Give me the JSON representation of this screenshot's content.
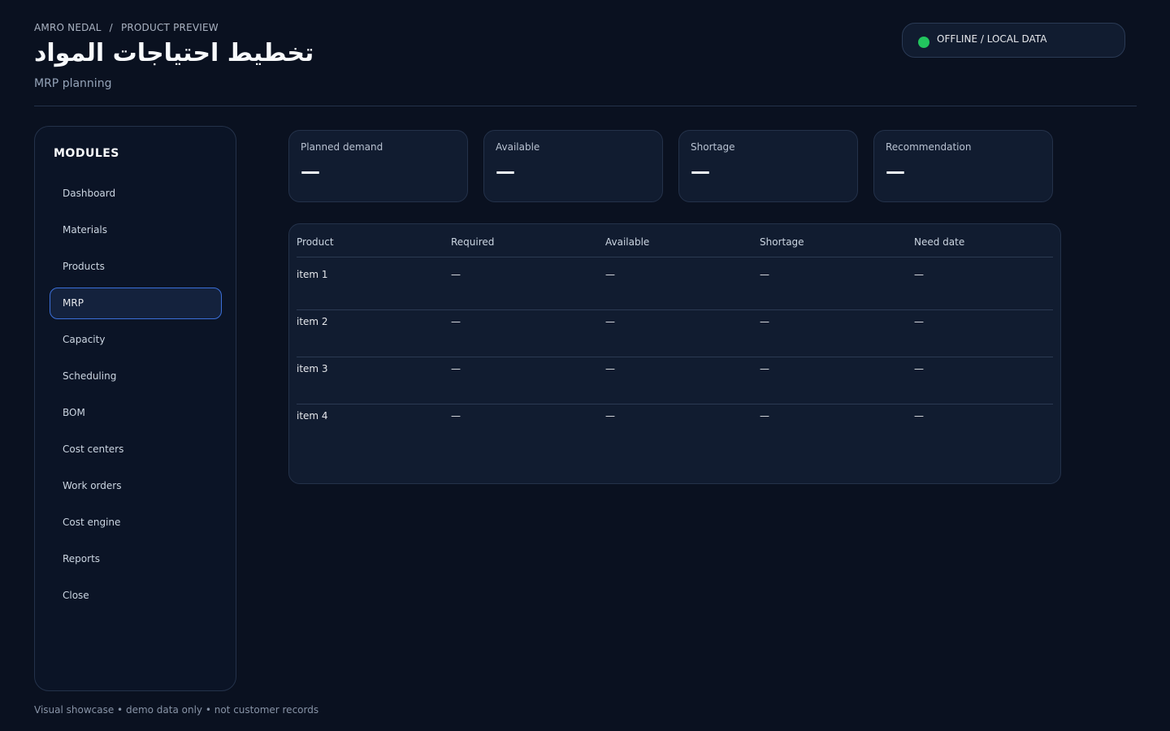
{
  "breadcrumb": {
    "owner": "AMRO NEDAL",
    "separator": "/",
    "section": "PRODUCT PREVIEW"
  },
  "header": {
    "title": "تخطيط احتياجات المواد",
    "subtitle": "MRP planning"
  },
  "status": {
    "label": "OFFLINE / LOCAL DATA",
    "color": "#22c55e"
  },
  "sidebar": {
    "heading": "MODULES",
    "items": [
      {
        "label": "Dashboard",
        "active": false
      },
      {
        "label": "Materials",
        "active": false
      },
      {
        "label": "Products",
        "active": false
      },
      {
        "label": "MRP",
        "active": true
      },
      {
        "label": "Capacity",
        "active": false
      },
      {
        "label": "Scheduling",
        "active": false
      },
      {
        "label": "BOM",
        "active": false
      },
      {
        "label": "Cost centers",
        "active": false
      },
      {
        "label": "Work orders",
        "active": false
      },
      {
        "label": "Cost engine",
        "active": false
      },
      {
        "label": "Reports",
        "active": false
      },
      {
        "label": "Close",
        "active": false
      }
    ]
  },
  "kpis": [
    {
      "label": "Planned demand",
      "value": "—"
    },
    {
      "label": "Available",
      "value": "—"
    },
    {
      "label": "Shortage",
      "value": "—"
    },
    {
      "label": "Recommendation",
      "value": "—"
    }
  ],
  "table": {
    "columns": [
      "Product",
      "Required",
      "Available",
      "Shortage",
      "Need date"
    ],
    "rows": [
      [
        "item 1",
        "—",
        "—",
        "—",
        "—"
      ],
      [
        "item 2",
        "—",
        "—",
        "—",
        "—"
      ],
      [
        "item 3",
        "—",
        "—",
        "—",
        "—"
      ],
      [
        "item 4",
        "—",
        "—",
        "—",
        "—"
      ]
    ]
  },
  "footer": {
    "note": "Visual showcase • demo data only • not customer records"
  },
  "colors": {
    "background": "#0a1120",
    "panel": "#111c30",
    "accent": "#3b6fd8",
    "status_online": "#22c55e"
  }
}
